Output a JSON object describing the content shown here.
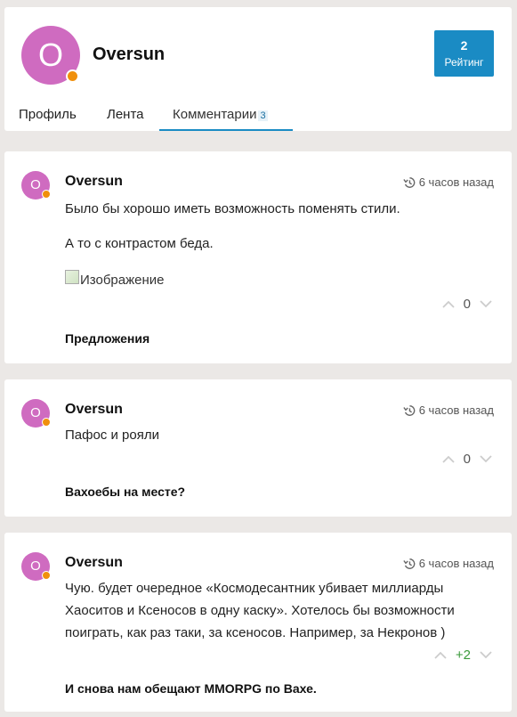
{
  "profile": {
    "avatar_letter": "O",
    "name": "Oversun",
    "rating": {
      "value": "2",
      "label": "Рейтинг"
    },
    "tabs": [
      {
        "label": "Профиль"
      },
      {
        "label": "Лента"
      },
      {
        "label": "Комментарии",
        "count": "3"
      }
    ]
  },
  "comments": [
    {
      "avatar_letter": "O",
      "author": "Oversun",
      "time": "6 часов назад",
      "paragraphs": [
        "Было бы хорошо иметь возможность поменять стили.",
        "А то с контрастом беда."
      ],
      "image_alt": "Изображение",
      "votes": "0",
      "topic": "Предложения"
    },
    {
      "avatar_letter": "O",
      "author": "Oversun",
      "time": "6 часов назад",
      "paragraphs": [
        "Пафос и рояли"
      ],
      "votes": "0",
      "topic": "Вахоебы на месте?"
    },
    {
      "avatar_letter": "O",
      "author": "Oversun",
      "time": "6 часов назад",
      "paragraphs": [
        "Чую. будет очередное «Космодесантник убивает миллиарды Хаоситов и Ксеносов в одну каску». Хотелось бы возможности поиграть, как раз таки, за ксеносов. Например, за Некронов )"
      ],
      "votes": "+2",
      "topic": "И снова нам обещают MMORPG по Вахе."
    }
  ],
  "colors": {
    "accent": "#1a8bc4",
    "avatar": "#cf6bc0",
    "status_dot": "#f0900c",
    "positive_vote": "#3a9a3a"
  },
  "icons": [
    "history-icon",
    "vote-up-icon",
    "vote-down-icon",
    "broken-image-icon"
  ]
}
